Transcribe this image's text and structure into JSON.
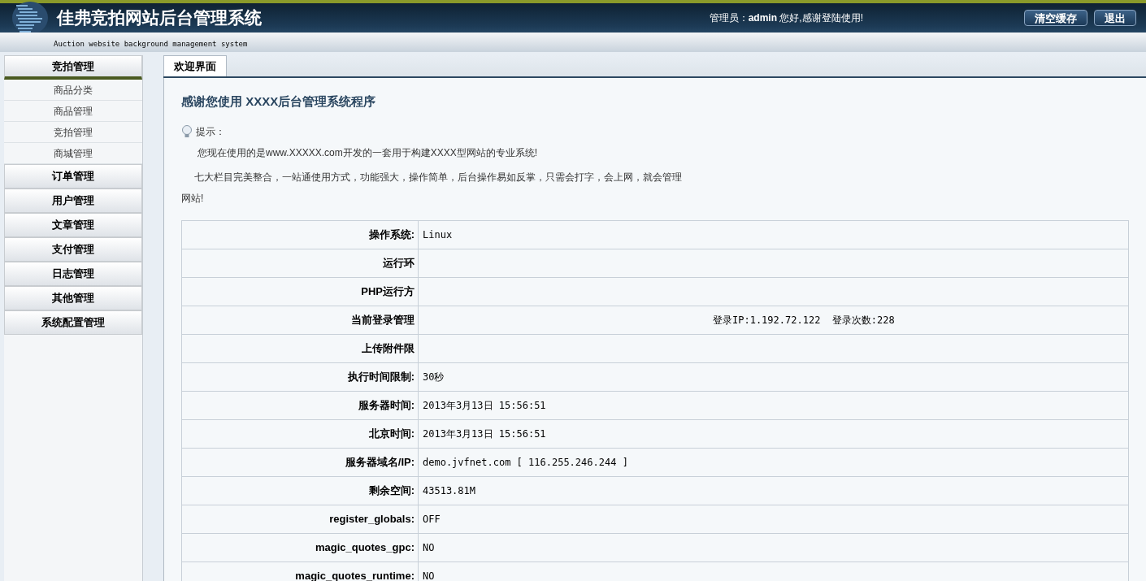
{
  "header": {
    "title": "佳弗竞拍网站后台管理系统",
    "subtitle": "Auction website background management system",
    "greeting_prefix": "管理员：",
    "user": "admin",
    "greeting": "您好,感谢登陆使用!",
    "buttons": [
      "清空缓存",
      "退出"
    ]
  },
  "sidebar": {
    "groups": [
      {
        "label": "竞拍管理",
        "expanded": true,
        "items": [
          "商品分类",
          "商品管理",
          "竞拍管理",
          "商城管理"
        ]
      },
      {
        "label": "订单管理",
        "expanded": false
      },
      {
        "label": "用户管理",
        "expanded": false
      },
      {
        "label": "文章管理",
        "expanded": false
      },
      {
        "label": "支付管理",
        "expanded": false
      },
      {
        "label": "日志管理",
        "expanded": false
      },
      {
        "label": "其他管理",
        "expanded": false
      },
      {
        "label": "系统配置管理",
        "expanded": false
      }
    ]
  },
  "tabs": [
    {
      "label": "欢迎界面",
      "selected": true
    }
  ],
  "welcome": {
    "title": "感谢您使用 XXXX后台管理系统程序",
    "tip_label": "提示：",
    "paragraphs": [
      "您现在使用的是www.XXXXX.com开发的一套用于构建XXXX型网站的专业系统!",
      "七大栏目完美整合，一站通使用方式，功能强大，操作简单，后台操作易如反掌，只需会打字，会上网，就会管理网站!"
    ]
  },
  "table": {
    "rows": [
      {
        "label": "操作系统:",
        "value": "Linux"
      },
      {
        "label": "运行环"
      },
      {
        "label": "PHP运行方"
      },
      {
        "label": "当前登录管理",
        "value": "登录IP:1.192.72.122  登录次数:228",
        "value_offset": true
      },
      {
        "label": "上传附件限"
      },
      {
        "label": "执行时间限制:",
        "value": "30秒"
      },
      {
        "label": "服务器时间:",
        "value": "2013年3月13日 15:56:51"
      },
      {
        "label": "北京时间:",
        "value": "2013年3月13日 15:56:51"
      },
      {
        "label": "服务器域名/IP:",
        "value": "demo.jvfnet.com [ 116.255.246.244 ]"
      },
      {
        "label": "剩余空间:",
        "value": "43513.81M"
      },
      {
        "label": "register_globals:",
        "value": "OFF"
      },
      {
        "label": "magic_quotes_gpc:",
        "value": "NO"
      },
      {
        "label": "magic_quotes_runtime:",
        "value": "NO"
      }
    ]
  }
}
